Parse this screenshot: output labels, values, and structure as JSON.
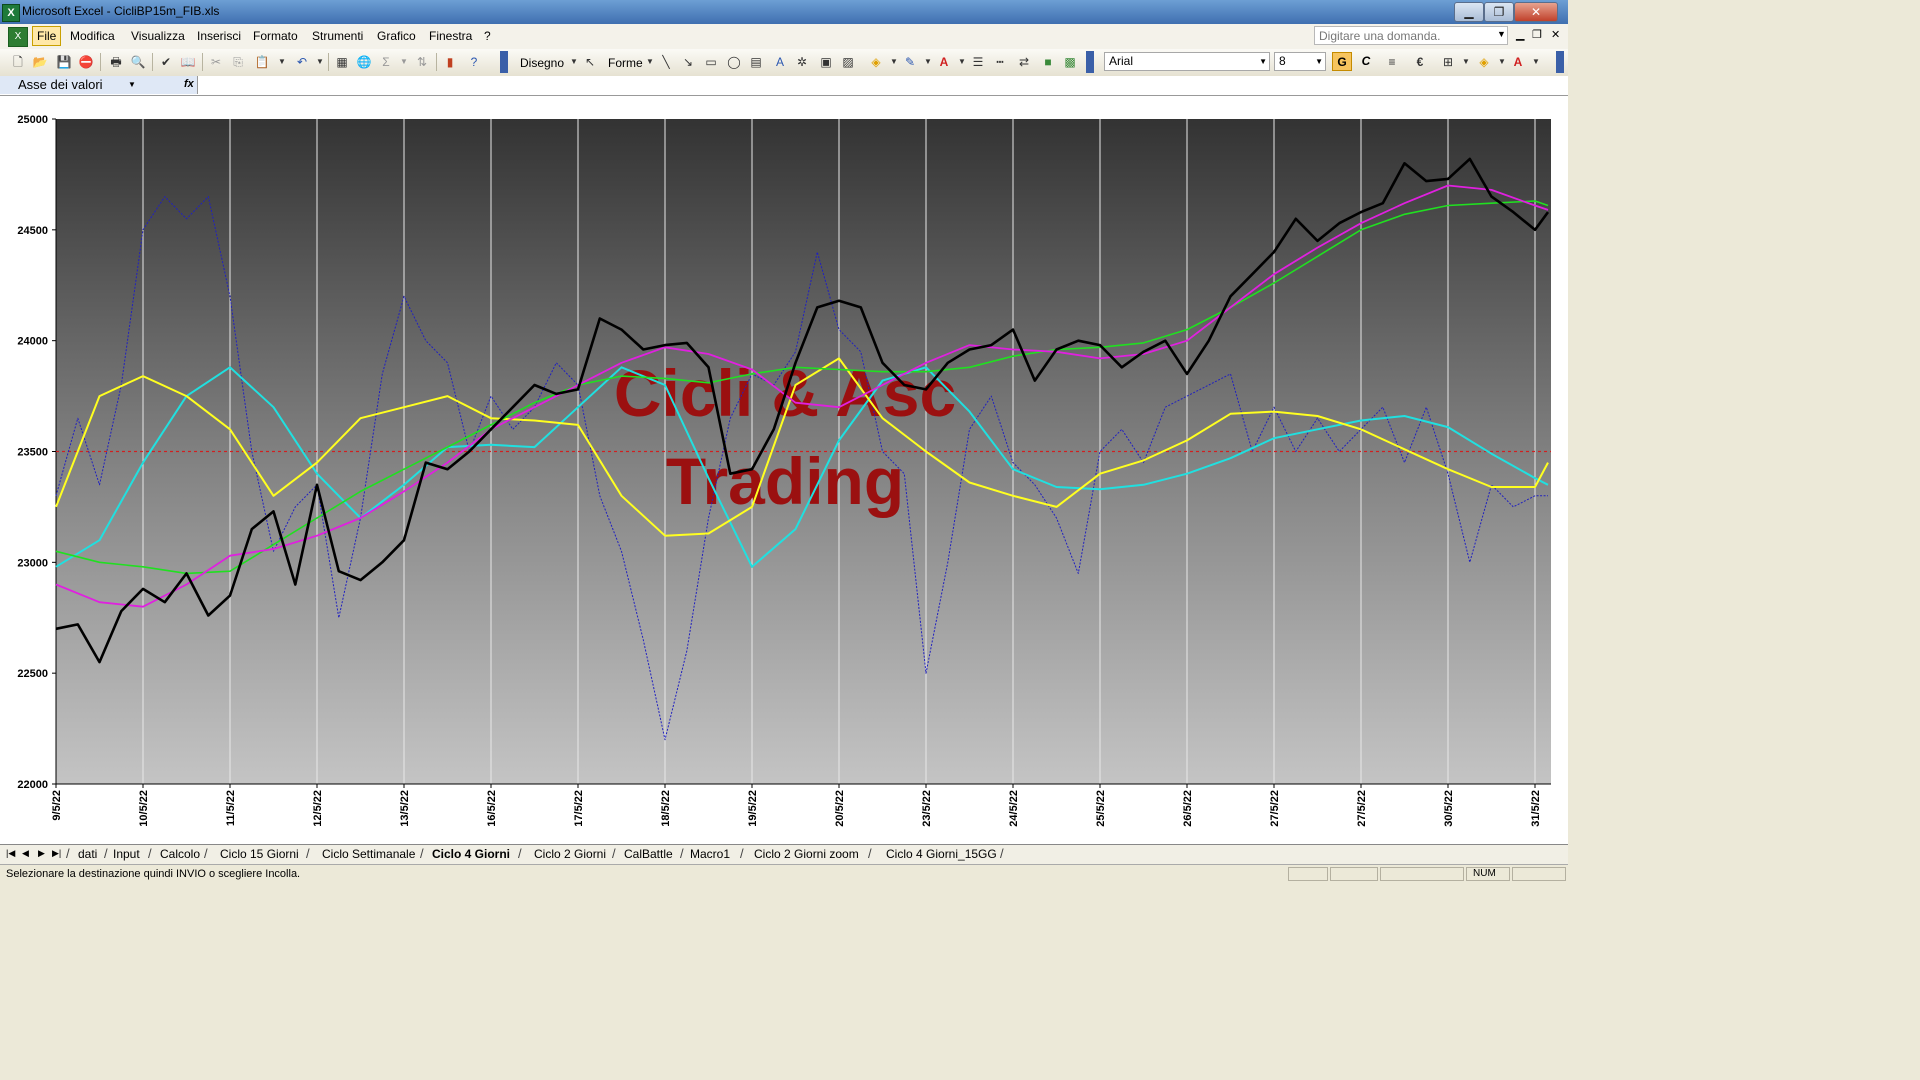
{
  "window": {
    "title": "Microsoft Excel - CicliBP15m_FIB.xls",
    "minimize": "▁",
    "restore": "❐",
    "close": "✕"
  },
  "menu": {
    "items": [
      "File",
      "Modifica",
      "Visualizza",
      "Inserisci",
      "Formato",
      "Strumenti",
      "Grafico",
      "Finestra",
      "?"
    ],
    "help_placeholder": "Digitare una domanda.",
    "doc_minimize": "▁",
    "doc_restore": "❐",
    "doc_close": "✕"
  },
  "toolbar": {
    "drawing_label": "Disegno",
    "shapes_label": "Forme",
    "font_name": "Arial",
    "font_size": "8",
    "bold_label": "G",
    "italic_label": "C",
    "euro_label": "€",
    "sum_label": "Σ",
    "icons": [
      "new-icon",
      "open-icon",
      "save-icon",
      "permission-icon",
      "print-icon",
      "print-preview-icon",
      "spelling-icon",
      "research-icon",
      "cut-icon",
      "copy-icon",
      "paste-icon",
      "undo-icon",
      "redo-icon",
      "chart-wizard-icon",
      "hyperlink-icon",
      "autosum-icon",
      "sort-icon",
      "chart-icon",
      "help-icon"
    ]
  },
  "formula_bar": {
    "name_box": "Asse dei valori",
    "fx_label": "fx"
  },
  "chart_data": {
    "type": "line",
    "watermark": [
      "Cicli & Asc",
      "Trading"
    ],
    "ylim": [
      22000,
      25000
    ],
    "yticks": [
      22000,
      22500,
      23000,
      23500,
      24000,
      24500,
      25000
    ],
    "reference_line": 23500,
    "categories": [
      "9/5/22",
      "10/5/22",
      "11/5/22",
      "12/5/22",
      "13/5/22",
      "16/5/22",
      "17/5/22",
      "18/5/22",
      "19/5/22",
      "20/5/22",
      "23/5/22",
      "24/5/22",
      "25/5/22",
      "26/5/22",
      "27/5/22",
      "27/5/22",
      "30/5/22",
      "31/5/22"
    ],
    "colors": {
      "price": "#000000",
      "magenta": "#e020e0",
      "green": "#20e020",
      "yellow": "#ffff20",
      "cyan": "#20e0e0",
      "blue": "#2020c0",
      "reference": "#d02020",
      "watermark": "#9b1010"
    },
    "series": [
      {
        "key": "price",
        "x": [
          0,
          0.25,
          0.5,
          0.75,
          1,
          1.25,
          1.5,
          1.75,
          2,
          2.25,
          2.5,
          2.75,
          3,
          3.25,
          3.5,
          3.75,
          4,
          4.25,
          4.5,
          4.75,
          5,
          5.25,
          5.5,
          5.75,
          6,
          6.25,
          6.5,
          6.75,
          7,
          7.25,
          7.5,
          7.75,
          8,
          8.25,
          8.5,
          8.75,
          9,
          9.25,
          9.5,
          9.75,
          10,
          10.25,
          10.5,
          10.75,
          11,
          11.25,
          11.5,
          11.75,
          12,
          12.25,
          12.5,
          12.75,
          13,
          13.25,
          13.5,
          13.75,
          14,
          14.25,
          14.5,
          14.75,
          15,
          15.25,
          15.5,
          15.75,
          16,
          16.25,
          16.5,
          16.75,
          17,
          17.15
        ],
        "values": [
          22700,
          22720,
          22550,
          22780,
          22880,
          22820,
          22950,
          22760,
          22850,
          23150,
          23230,
          22900,
          23350,
          22960,
          22920,
          23000,
          23100,
          23450,
          23420,
          23500,
          23600,
          23700,
          23800,
          23760,
          23780,
          24100,
          24050,
          23960,
          23980,
          23990,
          23880,
          23400,
          23420,
          23600,
          23900,
          24150,
          24180,
          24150,
          23900,
          23800,
          23780,
          23900,
          23960,
          23980,
          24050,
          23820,
          23960,
          24000,
          23980,
          23880,
          23950,
          24000,
          23850,
          24000,
          24200,
          24300,
          24400,
          24550,
          24450,
          24530,
          24580,
          24620,
          24800,
          24720,
          24730,
          24820,
          24650,
          24580,
          24500,
          24580
        ]
      },
      {
        "key": "magenta",
        "x": [
          0,
          0.5,
          1,
          1.5,
          2,
          2.5,
          3,
          3.5,
          4,
          4.5,
          5,
          5.5,
          6,
          6.5,
          7,
          7.5,
          8,
          8.5,
          9,
          9.5,
          10,
          10.5,
          11,
          11.5,
          12,
          12.5,
          13,
          13.5,
          14,
          14.5,
          15,
          15.5,
          16,
          16.5,
          17,
          17.15
        ],
        "values": [
          22900,
          22820,
          22800,
          22900,
          23030,
          23060,
          23120,
          23200,
          23320,
          23450,
          23600,
          23700,
          23800,
          23900,
          23970,
          23940,
          23870,
          23720,
          23700,
          23800,
          23900,
          23980,
          23960,
          23950,
          23920,
          23940,
          24000,
          24150,
          24300,
          24420,
          24530,
          24620,
          24700,
          24680,
          24610,
          24590
        ]
      },
      {
        "key": "green",
        "x": [
          0,
          0.5,
          1,
          1.5,
          2,
          2.5,
          3,
          3.5,
          4,
          4.5,
          5,
          5.5,
          6,
          6.5,
          7,
          7.5,
          8,
          8.5,
          9,
          9.5,
          10,
          10.5,
          11,
          11.5,
          12,
          12.5,
          13,
          13.5,
          14,
          14.5,
          15,
          15.5,
          16,
          16.5,
          17,
          17.15
        ],
        "values": [
          23050,
          23000,
          22980,
          22950,
          22960,
          23080,
          23200,
          23320,
          23420,
          23520,
          23620,
          23720,
          23800,
          23840,
          23830,
          23810,
          23850,
          23880,
          23870,
          23860,
          23860,
          23880,
          23930,
          23960,
          23970,
          23990,
          24050,
          24150,
          24260,
          24380,
          24500,
          24570,
          24610,
          24620,
          24630,
          24610
        ]
      },
      {
        "key": "yellow",
        "x": [
          0,
          0.5,
          1,
          1.5,
          2,
          2.5,
          3,
          3.5,
          4,
          4.5,
          5,
          5.5,
          6,
          6.5,
          7,
          7.5,
          8,
          8.5,
          9,
          9.5,
          10,
          10.5,
          11,
          11.5,
          12,
          12.5,
          13,
          13.5,
          14,
          14.5,
          15,
          15.5,
          16,
          16.5,
          17,
          17.15
        ],
        "values": [
          23250,
          23750,
          23840,
          23750,
          23600,
          23300,
          23450,
          23650,
          23700,
          23750,
          23650,
          23640,
          23620,
          23300,
          23120,
          23130,
          23250,
          23800,
          23920,
          23650,
          23500,
          23360,
          23300,
          23250,
          23400,
          23460,
          23550,
          23670,
          23680,
          23660,
          23600,
          23510,
          23420,
          23340,
          23340,
          23450
        ]
      },
      {
        "key": "cyan",
        "x": [
          0,
          0.5,
          1,
          1.5,
          2,
          2.5,
          3,
          3.5,
          4,
          4.5,
          5,
          5.5,
          6,
          6.5,
          7,
          7.5,
          8,
          8.5,
          9,
          9.5,
          10,
          10.5,
          11,
          11.5,
          12,
          12.5,
          13,
          13.5,
          14,
          14.5,
          15,
          15.5,
          16,
          16.5,
          17,
          17.15
        ],
        "values": [
          22980,
          23100,
          23450,
          23750,
          23880,
          23700,
          23400,
          23200,
          23350,
          23520,
          23530,
          23520,
          23700,
          23880,
          23800,
          23380,
          22980,
          23150,
          23550,
          23820,
          23880,
          23680,
          23420,
          23340,
          23330,
          23350,
          23400,
          23470,
          23560,
          23600,
          23640,
          23660,
          23610,
          23490,
          23380,
          23350
        ]
      },
      {
        "key": "blue",
        "x": [
          0,
          0.25,
          0.5,
          0.75,
          1,
          1.25,
          1.5,
          1.75,
          2,
          2.25,
          2.5,
          2.75,
          3,
          3.25,
          3.5,
          3.75,
          4,
          4.25,
          4.5,
          4.75,
          5,
          5.25,
          5.5,
          5.75,
          6,
          6.25,
          6.5,
          6.75,
          7,
          7.25,
          7.5,
          7.75,
          8,
          8.25,
          8.5,
          8.75,
          9,
          9.25,
          9.5,
          9.75,
          10,
          10.25,
          10.5,
          10.75,
          11,
          11.25,
          11.5,
          11.75,
          12,
          12.25,
          12.5,
          12.75,
          13,
          13.25,
          13.5,
          13.75,
          14,
          14.25,
          14.5,
          14.75,
          15,
          15.25,
          15.5,
          15.75,
          16,
          16.25,
          16.5,
          16.75,
          17,
          17.15
        ],
        "values": [
          23300,
          23650,
          23350,
          23800,
          24500,
          24650,
          24550,
          24650,
          24200,
          23500,
          23050,
          23250,
          23350,
          22750,
          23200,
          23850,
          24200,
          24000,
          23900,
          23500,
          23750,
          23600,
          23700,
          23900,
          23800,
          23300,
          23050,
          22650,
          22200,
          22600,
          23200,
          23650,
          23850,
          23800,
          23950,
          24400,
          24050,
          23950,
          23500,
          23400,
          22500,
          23000,
          23600,
          23750,
          23450,
          23350,
          23200,
          22950,
          23500,
          23600,
          23450,
          23700,
          23750,
          23800,
          23850,
          23500,
          23700,
          23500,
          23650,
          23500,
          23600,
          23700,
          23450,
          23700,
          23400,
          23000,
          23350,
          23250,
          23300,
          23300
        ]
      }
    ]
  },
  "sheet_tabs": {
    "active": "Ciclo 4 Giorni",
    "items": [
      "dati",
      "Input",
      "Calcolo",
      "Ciclo 15 Giorni",
      "Ciclo Settimanale",
      "Ciclo 4 Giorni",
      "Ciclo 2 Giorni",
      "CalBattle",
      "Macro1",
      "Ciclo 2 Giorni zoom",
      "Ciclo 4 Giorni_15GG"
    ]
  },
  "status": {
    "message": "Selezionare la destinazione quindi INVIO o scegliere Incolla.",
    "num": "NUM"
  }
}
